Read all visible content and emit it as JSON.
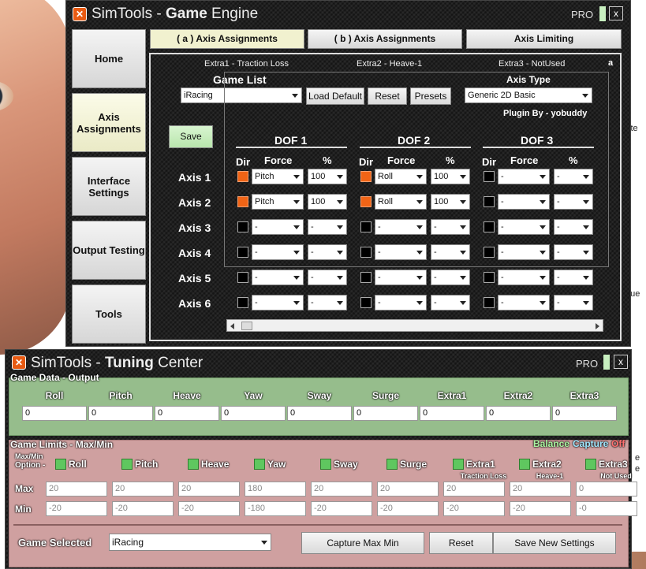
{
  "game_engine": {
    "title_prefix": "SimTools - ",
    "title_bold": "Game",
    "title_suffix": " Engine",
    "pro_label": "PRO",
    "close_label": "x",
    "nav": [
      "Home",
      "Axis Assignments",
      "Interface Settings",
      "Output Testing",
      "Tools"
    ],
    "tabs": [
      "( a ) Axis Assignments",
      "( b ) Axis Assignments",
      "Axis Limiting"
    ],
    "extras": [
      "Extra1 - Traction Loss",
      "Extra2 - Heave-1",
      "Extra3 - NotUsed"
    ],
    "corner_label": "a",
    "game_list_label": "Game List",
    "game_value": "iRacing",
    "load_default_label": "Load Default",
    "reset_label": "Reset",
    "presets_label": "Presets",
    "axis_type_label": "Axis Type",
    "axis_type_value": "Generic 2D Basic",
    "plugin_by": "Plugin By - yobuddy",
    "save_label": "Save",
    "dof_headers": [
      "DOF 1",
      "DOF 2",
      "DOF 3"
    ],
    "col_dir": "Dir",
    "col_force": "Force",
    "col_pct": "%",
    "axes": [
      {
        "label": "Axis 1",
        "dof": [
          {
            "dir": true,
            "force": "Pitch",
            "pct": "100"
          },
          {
            "dir": true,
            "force": "Roll",
            "pct": "100"
          },
          {
            "dir": false,
            "force": "-",
            "pct": "-"
          }
        ]
      },
      {
        "label": "Axis 2",
        "dof": [
          {
            "dir": true,
            "force": "Pitch",
            "pct": "100"
          },
          {
            "dir": true,
            "force": "Roll",
            "pct": "100"
          },
          {
            "dir": false,
            "force": "-",
            "pct": "-"
          }
        ]
      },
      {
        "label": "Axis 3",
        "dof": [
          {
            "dir": false,
            "force": "-",
            "pct": "-"
          },
          {
            "dir": false,
            "force": "-",
            "pct": "-"
          },
          {
            "dir": false,
            "force": "-",
            "pct": "-"
          }
        ]
      },
      {
        "label": "Axis 4",
        "dof": [
          {
            "dir": false,
            "force": "-",
            "pct": "-"
          },
          {
            "dir": false,
            "force": "-",
            "pct": "-"
          },
          {
            "dir": false,
            "force": "-",
            "pct": "-"
          }
        ]
      },
      {
        "label": "Axis 5",
        "dof": [
          {
            "dir": false,
            "force": "-",
            "pct": "-"
          },
          {
            "dir": false,
            "force": "-",
            "pct": "-"
          },
          {
            "dir": false,
            "force": "-",
            "pct": "-"
          }
        ]
      },
      {
        "label": "Axis 6",
        "dof": [
          {
            "dir": false,
            "force": "-",
            "pct": "-"
          },
          {
            "dir": false,
            "force": "-",
            "pct": "-"
          },
          {
            "dir": false,
            "force": "-",
            "pct": "-"
          }
        ]
      }
    ]
  },
  "tuning_center": {
    "title_prefix": "SimTools - ",
    "title_bold": "Tuning",
    "title_suffix": " Center",
    "pro_label": "PRO",
    "close_label": "x",
    "game_data_title": "Game Data - Output",
    "channels": [
      "Roll",
      "Pitch",
      "Heave",
      "Yaw",
      "Sway",
      "Surge",
      "Extra1",
      "Extra2",
      "Extra3"
    ],
    "output_values": [
      "0",
      "0",
      "0",
      "0",
      "0",
      "0",
      "0",
      "0",
      "0"
    ],
    "game_limits_title": "Game Limits - Max/Min",
    "balance": "Balance",
    "capture": "Capture",
    "off": "Off",
    "option_label_1": "Max/Min",
    "option_label_2": "Option -",
    "extra_sublabels": [
      "Traction Loss",
      "Heave-1",
      "Not Used"
    ],
    "max_label": "Max",
    "min_label": "Min",
    "max_values": [
      "20",
      "20",
      "20",
      "180",
      "20",
      "20",
      "20",
      "20",
      "0"
    ],
    "min_values": [
      "-20",
      "-20",
      "-20",
      "-180",
      "-20",
      "-20",
      "-20",
      "-20",
      "-0"
    ],
    "game_selected_label": "Game Selected",
    "game_selected_value": "iRacing",
    "capture_btn": "Capture Max Min",
    "reset_btn": "Reset",
    "save_btn": "Save New Settings"
  },
  "background": {
    "snippets": [
      "ite",
      "que",
      "e",
      "e"
    ]
  }
}
